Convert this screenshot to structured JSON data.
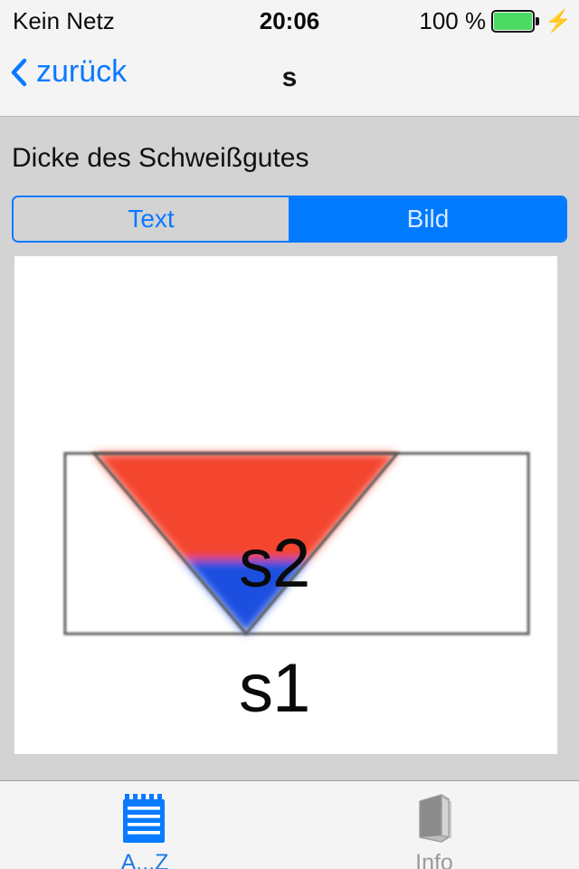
{
  "statusbar": {
    "carrier": "Kein Netz",
    "time": "20:06",
    "battery_percent": "100 %",
    "battery_icon": "battery-full-icon",
    "charging_icon": "lightning-bolt-icon",
    "battery_color": "#4cd964"
  },
  "navbar": {
    "back_label": "zurück",
    "back_icon": "chevron-left-icon",
    "title": "s",
    "tint_color": "#0a7aff"
  },
  "content": {
    "section_label": "Dicke des Schweißgutes",
    "segmented": {
      "options": [
        {
          "label": "Text",
          "selected": false
        },
        {
          "label": "Bild",
          "selected": true
        }
      ],
      "selected_value": "Bild",
      "accent_color": "#007aff"
    },
    "figure": {
      "name": "weld-cross-section-diagram",
      "labels": [
        {
          "text": "s2",
          "region": "upper-weld-red"
        },
        {
          "text": "s1",
          "region": "lower-weld-blue"
        }
      ],
      "colors": {
        "base_metal_outline": "#6e6e6e",
        "upper_weld": "#f4442e",
        "lower_weld": "#1f4fe0",
        "background": "#ffffff"
      }
    }
  },
  "tabbar": {
    "items": [
      {
        "label": "A...Z",
        "icon": "notepad-icon",
        "selected": true
      },
      {
        "label": "Info",
        "icon": "book-icon",
        "selected": false
      }
    ],
    "selected_color": "#1c7ae8",
    "unselected_color": "#9a9a9a"
  }
}
